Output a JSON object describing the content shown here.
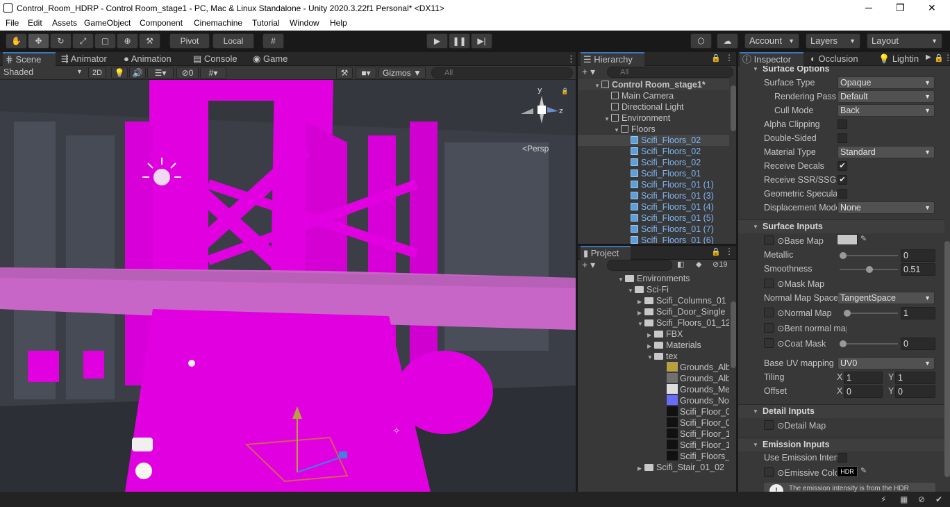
{
  "window": {
    "title": "Control_Room_HDRP - Control Room_stage1 - PC, Mac & Linux Standalone - Unity 2020.3.22f1 Personal* <DX11>",
    "minimize": "─",
    "restore": "❐",
    "close": "✕"
  },
  "menu": [
    "File",
    "Edit",
    "Assets",
    "GameObject",
    "Component",
    "Cinemachine",
    "Tutorial",
    "Window",
    "Help"
  ],
  "toolbar": {
    "pivot": "Pivot",
    "local": "Local",
    "account": "Account",
    "layers": "Layers",
    "layout": "Layout"
  },
  "scene_tabs": [
    "Scene",
    "Animator",
    "Animation",
    "Console",
    "Game"
  ],
  "scene_toolbar": {
    "shading": "Shaded",
    "mode2d": "2D",
    "hidden_count": "0",
    "gizmos": "Gizmos",
    "search_placeholder": "All"
  },
  "gizmo": {
    "y": "y",
    "z": "z",
    "persp": "<Persp"
  },
  "hierarchy": {
    "tab": "Hierarchy",
    "search_placeholder": "All",
    "items": [
      {
        "label": "Control Room_stage1*",
        "kind": "scene",
        "indent": 0,
        "blue": false
      },
      {
        "label": "Main Camera",
        "kind": "obj",
        "indent": 1,
        "blue": false
      },
      {
        "label": "Directional Light",
        "kind": "obj",
        "indent": 1,
        "blue": false
      },
      {
        "label": "Environment",
        "kind": "obj",
        "indent": 1,
        "blue": false
      },
      {
        "label": "Floors",
        "kind": "obj",
        "indent": 2,
        "blue": false
      },
      {
        "label": "Scifi_Floors_02",
        "kind": "prefab",
        "indent": 3,
        "blue": true
      },
      {
        "label": "Scifi_Floors_02",
        "kind": "prefab",
        "indent": 3,
        "blue": true
      },
      {
        "label": "Scifi_Floors_02",
        "kind": "prefab",
        "indent": 3,
        "blue": true
      },
      {
        "label": "Scifi_Floors_01",
        "kind": "prefab",
        "indent": 3,
        "blue": true
      },
      {
        "label": "Scifi_Floors_01 (1)",
        "kind": "prefab",
        "indent": 3,
        "blue": true
      },
      {
        "label": "Scifi_Floors_01 (3)",
        "kind": "prefab",
        "indent": 3,
        "blue": true
      },
      {
        "label": "Scifi_Floors_01 (4)",
        "kind": "prefab",
        "indent": 3,
        "blue": true
      },
      {
        "label": "Scifi_Floors_01 (5)",
        "kind": "prefab",
        "indent": 3,
        "blue": true
      },
      {
        "label": "Scifi_Floors_01 (7)",
        "kind": "prefab",
        "indent": 3,
        "blue": true
      },
      {
        "label": "Scifi_Floors_01 (6)",
        "kind": "prefab",
        "indent": 3,
        "blue": true
      }
    ]
  },
  "project": {
    "tab": "Project",
    "hidden_count": "19",
    "items": [
      {
        "label": "Environments",
        "kind": "folder",
        "indent": 0
      },
      {
        "label": "Sci-Fi",
        "kind": "folder",
        "indent": 1
      },
      {
        "label": "Scifi_Columns_01",
        "kind": "folder",
        "indent": 2
      },
      {
        "label": "Scifi_Door_Single",
        "kind": "folder",
        "indent": 2
      },
      {
        "label": "Scifi_Floors_01_12",
        "kind": "folder",
        "indent": 2
      },
      {
        "label": "FBX",
        "kind": "folder",
        "indent": 3
      },
      {
        "label": "Materials",
        "kind": "folder",
        "indent": 3
      },
      {
        "label": "tex",
        "kind": "folder",
        "indent": 3
      },
      {
        "label": "Grounds_Alb",
        "kind": "tex-y",
        "indent": 4
      },
      {
        "label": "Grounds_Alb",
        "kind": "tex-g",
        "indent": 4
      },
      {
        "label": "Grounds_Me",
        "kind": "tex-w",
        "indent": 4
      },
      {
        "label": "Grounds_Nor",
        "kind": "tex-b",
        "indent": 4
      },
      {
        "label": "Scifi_Floor_0",
        "kind": "tex-k",
        "indent": 4
      },
      {
        "label": "Scifi_Floor_0",
        "kind": "tex-k",
        "indent": 4
      },
      {
        "label": "Scifi_Floor_1",
        "kind": "tex-k",
        "indent": 4
      },
      {
        "label": "Scifi_Floor_1",
        "kind": "tex-k",
        "indent": 4
      },
      {
        "label": "Scifi_Floors_",
        "kind": "tex-k",
        "indent": 4
      },
      {
        "label": "Scifi_Stair_01_02",
        "kind": "folder",
        "indent": 2
      }
    ]
  },
  "inspector": {
    "tabs": [
      "Inspector",
      "Occlusion",
      "Lightin"
    ],
    "surface_options": {
      "header": "Surface Options",
      "surface_type": {
        "label": "Surface Type",
        "value": "Opaque"
      },
      "rendering_pass": {
        "label": "Rendering Pass",
        "value": "Default"
      },
      "cull_mode": {
        "label": "Cull Mode",
        "value": "Back"
      },
      "alpha_clipping": {
        "label": "Alpha Clipping",
        "checked": false
      },
      "double_sided": {
        "label": "Double-Sided",
        "checked": false
      },
      "material_type": {
        "label": "Material Type",
        "value": "Standard"
      },
      "receive_decals": {
        "label": "Receive Decals",
        "checked": true
      },
      "receive_ssr": {
        "label": "Receive SSR/SSGI",
        "checked": true
      },
      "geometric_specular": {
        "label": "Geometric Specular AA",
        "checked": false
      },
      "displacement": {
        "label": "Displacement Mode",
        "value": "None"
      }
    },
    "surface_inputs": {
      "header": "Surface Inputs",
      "base_map": {
        "label": "Base Map"
      },
      "metallic": {
        "label": "Metallic",
        "value": "0",
        "fraction": 0
      },
      "smoothness": {
        "label": "Smoothness",
        "value": "0.51",
        "fraction": 0.51
      },
      "mask_map": {
        "label": "Mask Map"
      },
      "normal_space": {
        "label": "Normal Map Space",
        "value": "TangentSpace"
      },
      "normal_map": {
        "label": "Normal Map",
        "value": "1",
        "fraction": 0
      },
      "bent_normal": {
        "label": "Bent normal map"
      },
      "coat_mask": {
        "label": "Coat Mask",
        "value": "0",
        "fraction": 0
      },
      "base_uv": {
        "label": "Base UV mapping",
        "value": "UV0"
      },
      "tiling": {
        "label": "Tiling",
        "x": "1",
        "y": "1"
      },
      "offset": {
        "label": "Offset",
        "x": "0",
        "y": "0"
      },
      "x": "X",
      "y": "Y"
    },
    "detail_inputs": {
      "header": "Detail Inputs",
      "detail_map": "Detail Map"
    },
    "emission_inputs": {
      "header": "Emission Inputs",
      "use_intensity": "Use Emission Intensity",
      "emissive_color": "Emissive Color",
      "hdr": "HDR",
      "info": "The emission intensity is from the HDR"
    }
  },
  "colors": {
    "magenta": "#e000e0",
    "panel": "#383838",
    "accent": "#3a79bb"
  }
}
